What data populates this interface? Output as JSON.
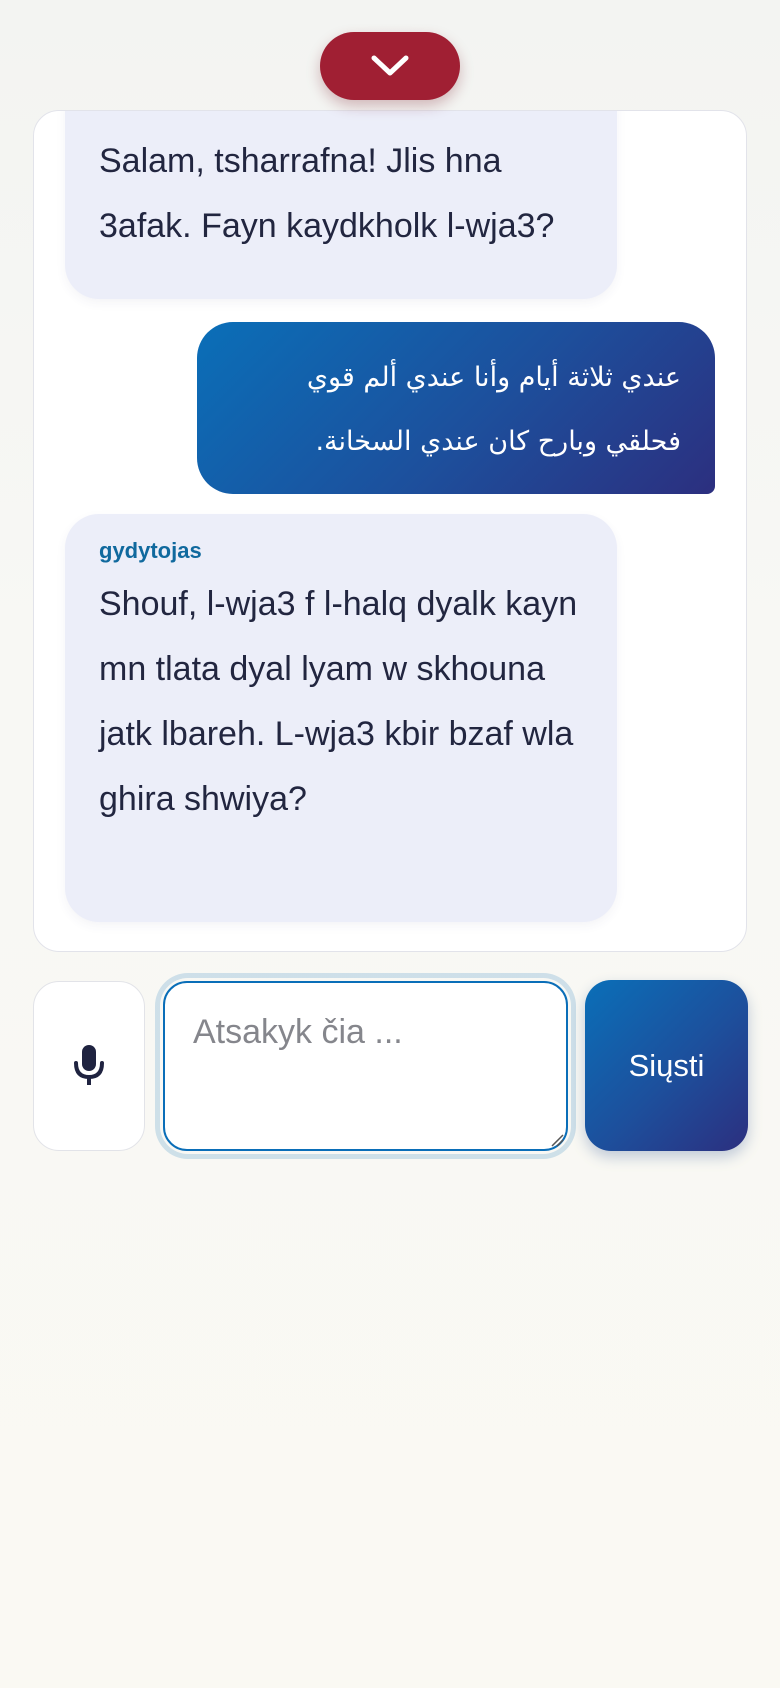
{
  "header": {
    "collapse_icon": "chevron-down-icon",
    "accent_color": "#a01f33"
  },
  "chat": {
    "messages": [
      {
        "role": "assistant",
        "sender": "",
        "text": "Salam, tsharrafna! Jlis hna 3afak. Fayn kaydkholk l-wja3?"
      },
      {
        "role": "user",
        "text": "عندي ثلاثة أيام وأنا عندي ألم قوي فحلقي وبارح كان عندي السخانة."
      },
      {
        "role": "assistant",
        "sender": "gydytojas",
        "text": "Shouf, l-wja3 f l-halq dyalk kayn mn tlata dyal lyam w skhouna jatk lbareh. L-wja3 kbir bzaf wla ghira shwiya?"
      }
    ]
  },
  "composer": {
    "mic_icon": "microphone-icon",
    "input_value": "",
    "input_placeholder": "Atsakyk čia ...",
    "send_label": "Siųsti",
    "brand_gradient": [
      "#0a6fb8",
      "#2c2f7f"
    ]
  }
}
